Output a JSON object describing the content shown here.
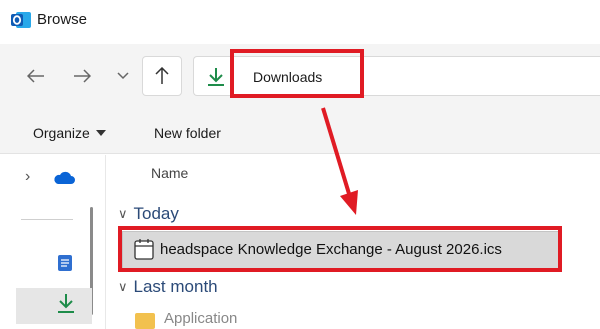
{
  "window": {
    "title": "Browse",
    "app_icon": "outlook-icon"
  },
  "navigation": {
    "back_icon": "arrow-left-icon",
    "forward_icon": "arrow-right-icon",
    "recent_icon": "chevron-down-icon",
    "up_icon": "arrow-up-icon",
    "address": {
      "location_icon": "download-icon",
      "separator": "›",
      "current": "Downloads"
    }
  },
  "commandbar": {
    "organize_label": "Organize",
    "new_folder_label": "New folder"
  },
  "navpane": {
    "items": [
      "onedrive-icon",
      "document-icon",
      "download-icon"
    ],
    "selected": "download-icon"
  },
  "filelist": {
    "column_header": "Name",
    "groups": [
      {
        "label": "Today",
        "items": [
          {
            "name": "headspace Knowledge Exchange - August 2026.ics",
            "icon": "calendar-file-icon",
            "selected": true
          }
        ]
      },
      {
        "label": "Last month",
        "items": [
          {
            "name": "Application",
            "icon": "folder-icon",
            "selected": false
          }
        ]
      }
    ]
  },
  "annotations": {
    "color": "#e01b24",
    "highlights": [
      "address-bar",
      "selected-file"
    ],
    "arrow": "address-bar-to-file"
  }
}
